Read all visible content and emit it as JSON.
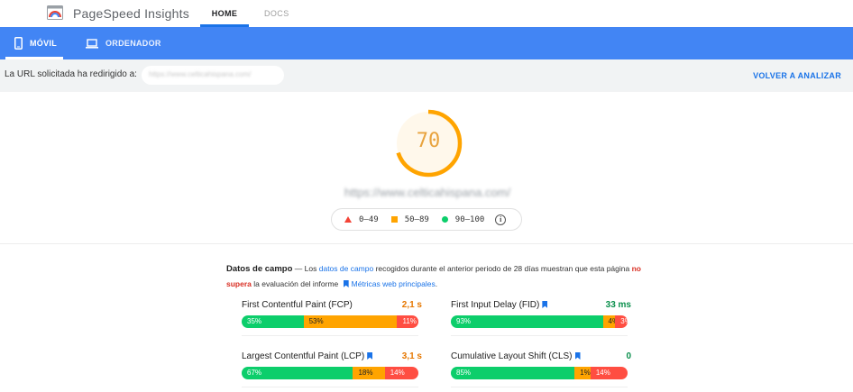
{
  "header": {
    "app_title": "PageSpeed Insights",
    "tabs": [
      "HOME",
      "DOCS"
    ]
  },
  "device_tabs": {
    "mobile": "MÓVIL",
    "desktop": "ORDENADOR"
  },
  "redirect": {
    "label": "La URL solicitada ha redirigido a:",
    "url": "https://www.celticahispana.com/",
    "action": "VOLVER A ANALIZAR"
  },
  "score": {
    "value": "70",
    "fraction": 0.7,
    "color": "#ffa400",
    "url": "https://www.celticahispana.com/"
  },
  "legend": {
    "poor": "0–49",
    "average": "50–89",
    "good": "90–100"
  },
  "field_data": {
    "title": "Datos de campo",
    "dash": "—",
    "text_1": "Los",
    "link_1": "datos de campo",
    "text_2": "recogidos durante el anterior periodo de 28 días muestran que esta página",
    "verdict": "no supera",
    "text_3": "la evaluación del informe",
    "link_2": "Métricas web principales",
    "end": "."
  },
  "metrics": [
    {
      "name": "First Contentful Paint (FCP)",
      "value": "2,1 s",
      "status": "average",
      "value_color": "#e67700",
      "bookmark": false,
      "dist": [
        {
          "label": "35%",
          "pct": 35
        },
        {
          "label": "53%",
          "pct": 53
        },
        {
          "label": "11%",
          "pct": 12
        }
      ]
    },
    {
      "name": "First Input Delay (FID)",
      "value": "33 ms",
      "status": "good",
      "value_color": "#0a8f4c",
      "bookmark": true,
      "dist": [
        {
          "label": "93%",
          "pct": 86
        },
        {
          "label": "4%",
          "pct": 7
        },
        {
          "label": "3%",
          "pct": 7
        }
      ]
    },
    {
      "name": "Largest Contentful Paint (LCP)",
      "value": "3,1 s",
      "status": "average",
      "value_color": "#e67700",
      "bookmark": true,
      "dist": [
        {
          "label": "67%",
          "pct": 63
        },
        {
          "label": "18%",
          "pct": 18
        },
        {
          "label": "14%",
          "pct": 19
        }
      ]
    },
    {
      "name": "Cumulative Layout Shift (CLS)",
      "value": "0",
      "status": "good",
      "value_color": "#0a8f4c",
      "bookmark": true,
      "dist": [
        {
          "label": "85%",
          "pct": 70
        },
        {
          "label": "1%",
          "pct": 9
        },
        {
          "label": "14%",
          "pct": 21
        }
      ]
    }
  ]
}
